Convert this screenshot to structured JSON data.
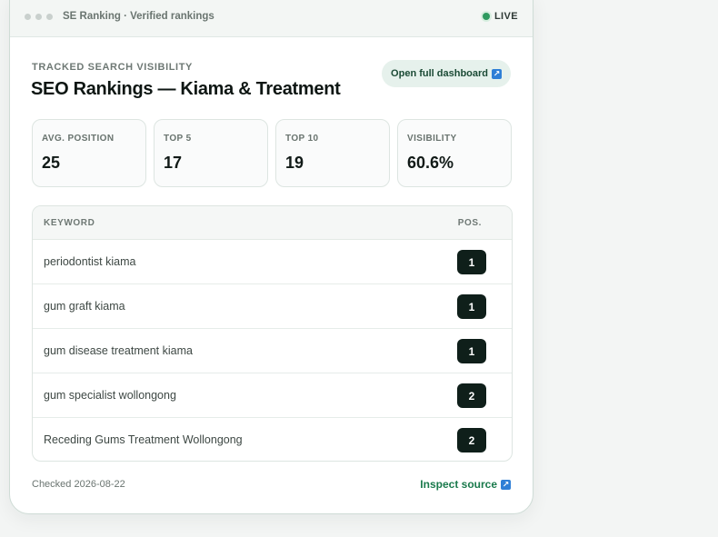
{
  "titlebar": {
    "title": "SE Ranking · Verified rankings",
    "live_label": "LIVE"
  },
  "header": {
    "eyebrow": "TRACKED SEARCH VISIBILITY",
    "title": "SEO Rankings — Kiama & Treatment",
    "dashboard_button": "Open full dashboard"
  },
  "stats": [
    {
      "label": "AVG. POSITION",
      "value": "25"
    },
    {
      "label": "TOP 5",
      "value": "17"
    },
    {
      "label": "TOP 10",
      "value": "19"
    },
    {
      "label": "VISIBILITY",
      "value": "60.6%"
    }
  ],
  "table": {
    "columns": {
      "keyword": "KEYWORD",
      "position": "POS."
    },
    "rows": [
      {
        "keyword": "periodontist kiama",
        "position": "1"
      },
      {
        "keyword": "gum graft kiama",
        "position": "1"
      },
      {
        "keyword": "gum disease treatment kiama",
        "position": "1"
      },
      {
        "keyword": "gum specialist wollongong",
        "position": "2"
      },
      {
        "keyword": "Receding Gums Treatment Wollongong",
        "position": "2"
      }
    ]
  },
  "footer": {
    "checked": "Checked 2026-08-22",
    "inspect_link": "Inspect source"
  },
  "icons": {
    "external": "external-link-icon",
    "live": "live-status-dot"
  },
  "colors": {
    "accent_green": "#1a7a4c",
    "live_dot": "#2e9a5f",
    "badge_bg": "#0f1f1a",
    "external_icon": "#2f7fd6"
  }
}
